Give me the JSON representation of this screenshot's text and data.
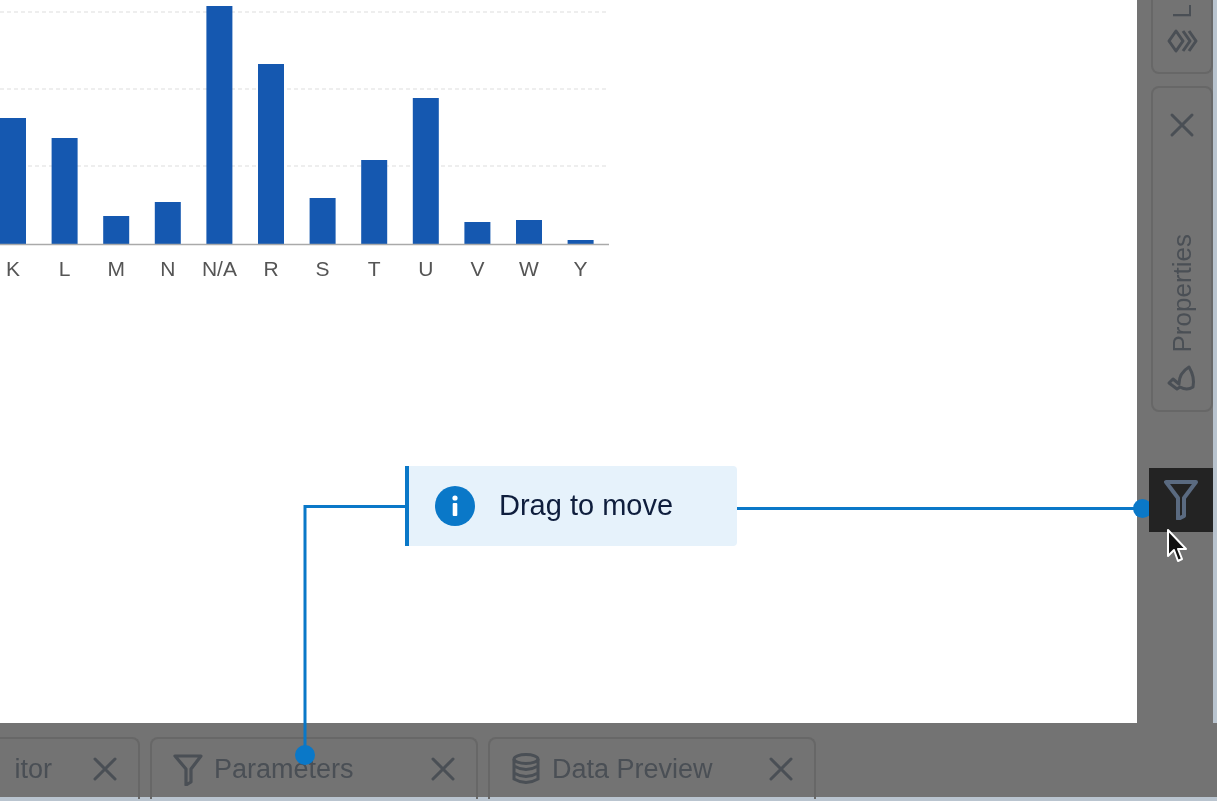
{
  "chart": {
    "categories": [
      "K",
      "L",
      "M",
      "N",
      "N/A",
      "R",
      "S",
      "T",
      "U",
      "V",
      "W",
      "Y"
    ]
  },
  "side_tabs": [
    {
      "label": "L",
      "kind": "layers",
      "closable": false
    },
    {
      "label": "Properties",
      "kind": "brush",
      "closable": true
    }
  ],
  "tooltip": {
    "text": "Drag to move"
  },
  "bottom_tabs": [
    {
      "label": "itor",
      "closable": true
    },
    {
      "label": "Parameters",
      "kind": "filter",
      "closable": true
    },
    {
      "label": "Data Preview",
      "kind": "database",
      "closable": true
    }
  ]
}
